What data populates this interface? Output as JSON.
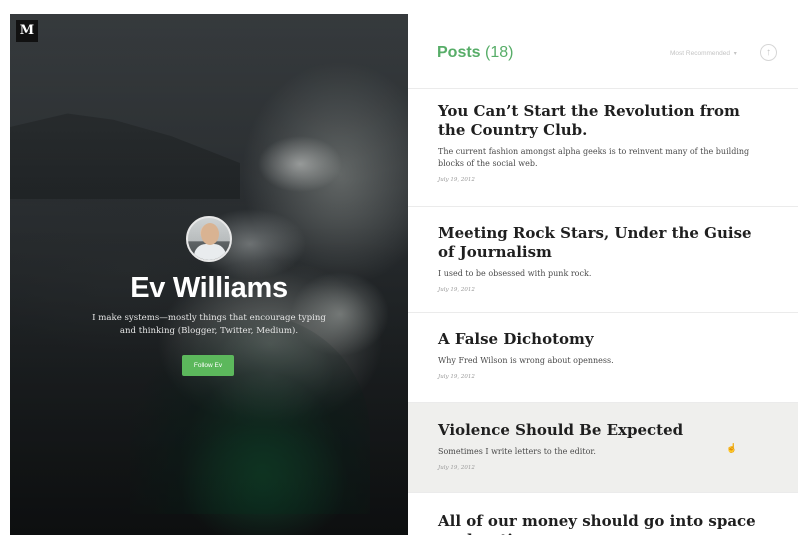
{
  "brand": {
    "logo_letter": "M"
  },
  "profile": {
    "name": "Ev Williams",
    "bio": "I make systems—mostly things that encourage typing and thinking (Blogger, Twitter, Medium).",
    "follow_label": "Follow Ev"
  },
  "posts_header": {
    "title": "Posts",
    "count": "(18)",
    "sort_label": "Most Recommended",
    "sort_caret": "▾",
    "scroll_icon": "↑"
  },
  "colors": {
    "accent": "#57ad68",
    "button": "#5cb85c",
    "highlight_row": "#efefed"
  },
  "posts": [
    {
      "title": "You Can’t Start the Revolution from the Country Club.",
      "excerpt": "The current fashion amongst alpha geeks is to reinvent many of the building blocks of the social web.",
      "date": "July 19, 2012"
    },
    {
      "title": "Meeting Rock Stars, Under the Guise of Journalism",
      "excerpt": "I used to be obsessed with punk rock.",
      "date": "July 19, 2012"
    },
    {
      "title": "A False Dichotomy",
      "excerpt": "Why Fred Wilson is wrong about openness.",
      "date": "July 19, 2012"
    },
    {
      "title": "Violence Should Be Expected",
      "excerpt": "Sometimes I write letters to the editor.",
      "date": "July 19, 2012"
    },
    {
      "title": "All of our money should go into space exploration",
      "excerpt": "",
      "date": ""
    }
  ]
}
